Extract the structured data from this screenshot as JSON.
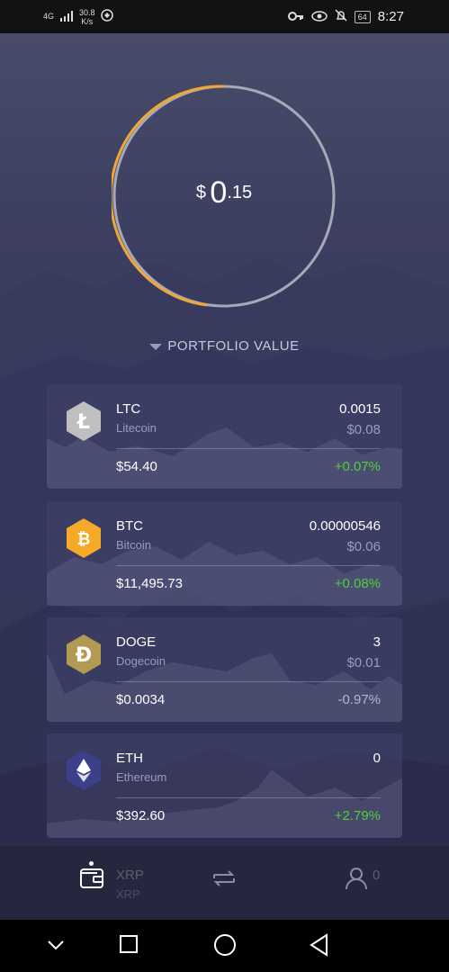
{
  "status_bar": {
    "signal": "4G",
    "speed_value": "30.8",
    "speed_unit": "K/s",
    "battery": "64",
    "time": "8:27"
  },
  "portfolio": {
    "currency_symbol": "$",
    "value_int": "0",
    "value_dec": ".15",
    "label": "PORTFOLIO VALUE"
  },
  "coins": [
    {
      "symbol": "LTC",
      "name": "Litecoin",
      "quantity": "0.0015",
      "fiat": "$0.08",
      "price": "$54.40",
      "change": "+0.07%",
      "change_color": "#4cd137",
      "icon_color": "#bfbfbf",
      "icon_glyph": "Ł"
    },
    {
      "symbol": "BTC",
      "name": "Bitcoin",
      "quantity": "0.00000546",
      "fiat": "$0.06",
      "price": "$11,495.73",
      "change": "+0.08%",
      "change_color": "#4cd137",
      "icon_color": "#f7a928",
      "icon_glyph": "₿"
    },
    {
      "symbol": "DOGE",
      "name": "Dogecoin",
      "quantity": "3",
      "fiat": "$0.01",
      "price": "$0.0034",
      "change": "-0.97%",
      "change_color": "#b5b6cc",
      "icon_color": "#b39a52",
      "icon_glyph": "Ð"
    },
    {
      "symbol": "ETH",
      "name": "Ethereum",
      "quantity": "0",
      "fiat": "",
      "price": "$392.60",
      "change": "+2.79%",
      "change_color": "#4cd137",
      "icon_color": "#3c3f8a",
      "icon_glyph": "◆"
    }
  ],
  "partial_row": {
    "symbol": "XRP",
    "name": "XRP",
    "quantity": "0"
  },
  "tabs": [
    {
      "name": "wallet",
      "icon": "wallet-icon"
    },
    {
      "name": "exchange",
      "icon": "exchange-icon"
    },
    {
      "name": "profile",
      "icon": "user-icon"
    }
  ],
  "colors": {
    "accent_orange": "#f0a834",
    "positive": "#4cd137",
    "ring_grey": "#a7a8b8"
  }
}
